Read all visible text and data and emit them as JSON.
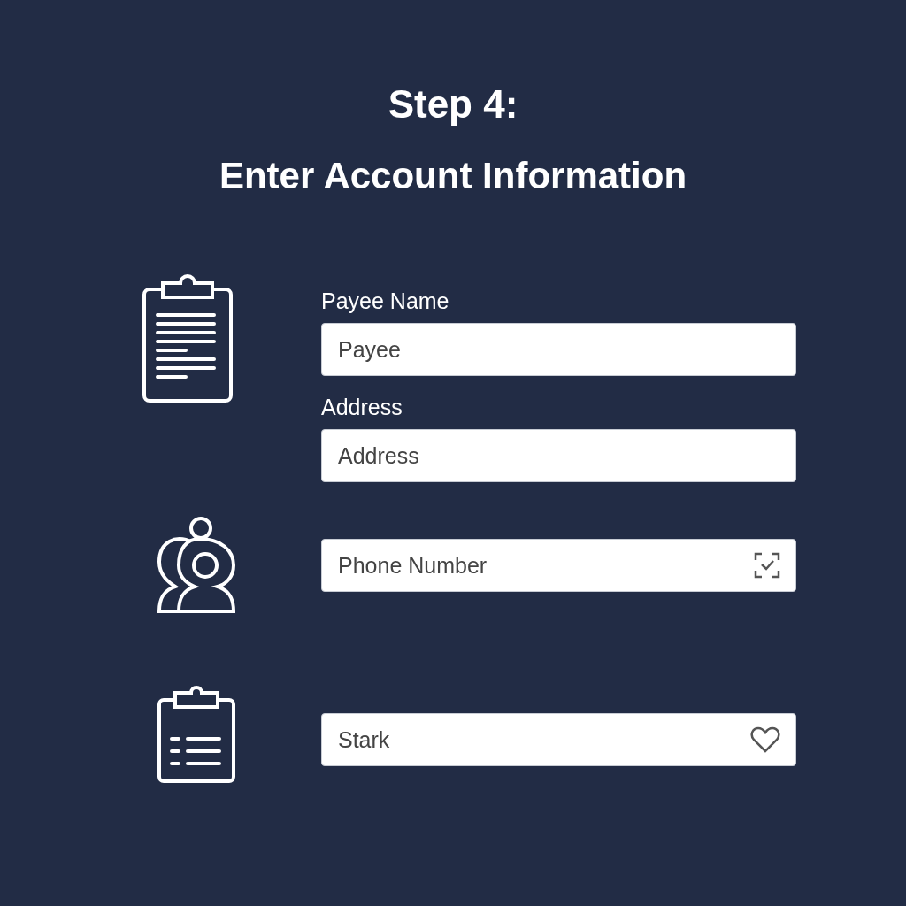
{
  "heading": {
    "step": "Step 4:",
    "title": "Enter Account Information"
  },
  "sections": [
    {
      "fields": [
        {
          "label": "Payee Name",
          "placeholder": "Payee"
        },
        {
          "label": "Address",
          "placeholder": "Address"
        }
      ]
    },
    {
      "fields": [
        {
          "placeholder": "Phone Number"
        }
      ]
    },
    {
      "fields": [
        {
          "value": "Stark"
        }
      ]
    }
  ]
}
